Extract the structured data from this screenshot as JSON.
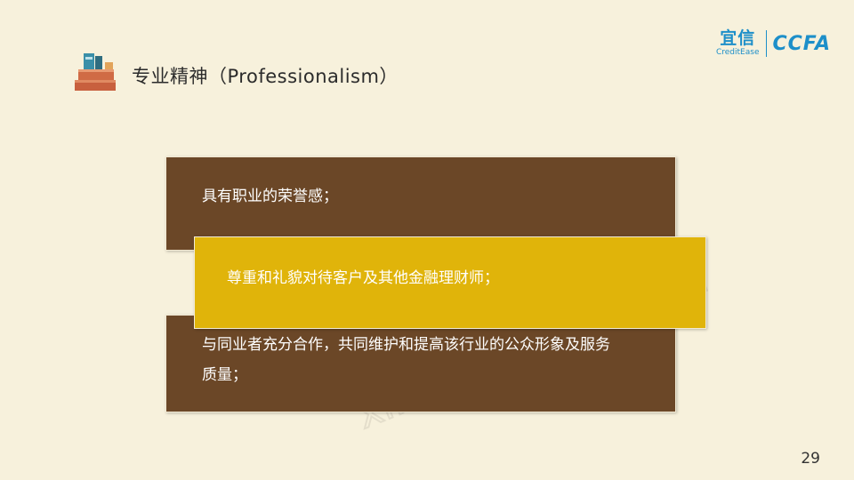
{
  "header": {
    "title": "专业精神（Professionalism）",
    "title_icon": "books-icon"
  },
  "logos": {
    "yixin_cn": "宜信",
    "yixin_en": "CreditEase",
    "ccfa": "CCFA"
  },
  "watermark": {
    "cn": "星火金服",
    "url": "xinghuo.yixin.com"
  },
  "items": [
    {
      "text": "具有职业的荣誉感；"
    },
    {
      "text": "尊重和礼貌对待客户及其他金融理财师；"
    },
    {
      "text": "与同业者充分合作，共同维护和提高该行业的公众形象及服务质量；"
    }
  ],
  "page_number": "29",
  "colors": {
    "background": "#f7f1dc",
    "brown_box": "#6b4727",
    "gold_box": "#e0b40a",
    "logo_blue": "#1d8fc9"
  }
}
